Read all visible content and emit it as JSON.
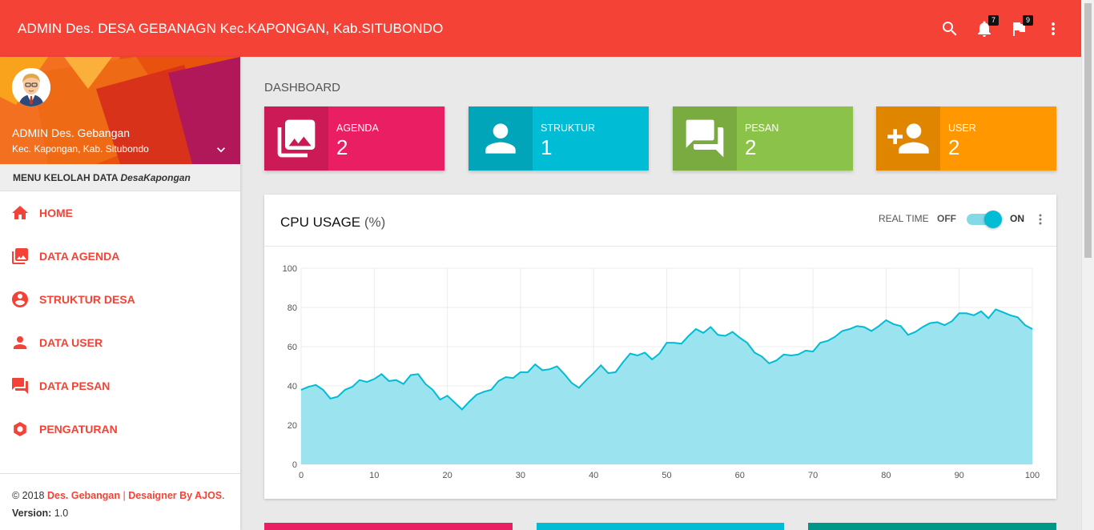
{
  "header": {
    "brand": "ADMIN Des. DESA GEBANAGN Kec.KAPONGAN, Kab.SITUBONDO",
    "notifications_count": "7",
    "flags_count": "9",
    "icons": [
      "search-icon",
      "bell-icon",
      "flag-icon",
      "more-vert-icon"
    ]
  },
  "sidebar": {
    "user_name": "ADMIN Des. Gebangan",
    "user_location": "Kec. Kapongan, Kab. Situbondo",
    "menu_title": "MENU KELOLAH DATA",
    "menu_title_italic": "DesaKapongan",
    "items": [
      {
        "label": "HOME",
        "icon": "home-icon"
      },
      {
        "label": "DATA AGENDA",
        "icon": "photo-library-icon"
      },
      {
        "label": "STRUKTUR DESA",
        "icon": "account-circle-icon"
      },
      {
        "label": "DATA USER",
        "icon": "person-icon"
      },
      {
        "label": "DATA PESAN",
        "icon": "forum-icon"
      },
      {
        "label": "PENGATURAN",
        "icon": "settings-icon"
      }
    ],
    "legal": {
      "copyright": "© 2018",
      "site_name": "Des. Gebangan",
      "separator": "|",
      "designer": "Desaigner By AJOS",
      "end": ".",
      "version_label": "Version:",
      "version": "1.0"
    }
  },
  "main": {
    "page_title": "DASHBOARD",
    "info_boxes": [
      {
        "label": "AGENDA",
        "value": "2",
        "color": "#e91e63",
        "icon": "photo-library-icon"
      },
      {
        "label": "STRUKTUR",
        "value": "1",
        "color": "#00bcd4",
        "icon": "person-icon"
      },
      {
        "label": "PESAN",
        "value": "2",
        "color": "#8bc34a",
        "icon": "forum-icon"
      },
      {
        "label": "USER",
        "value": "2",
        "color": "#ff9800",
        "icon": "person-add-icon"
      }
    ],
    "cpu_card": {
      "title": "CPU USAGE",
      "title_unit": "(%)",
      "realtime_label": "REAL TIME",
      "off_label": "OFF",
      "on_label": "ON",
      "realtime_on": true
    },
    "bottom_colors": [
      "#e91e63",
      "#00bcd4",
      "#009688"
    ]
  },
  "chart_data": {
    "type": "area",
    "color": "#00bcd4",
    "fill": "#9be3ee",
    "xlim": [
      0,
      100
    ],
    "ylim": [
      0,
      100
    ],
    "x_ticks": [
      0,
      10,
      20,
      30,
      40,
      50,
      60,
      70,
      80,
      90,
      100
    ],
    "y_ticks": [
      0,
      20,
      40,
      60,
      80,
      100
    ],
    "grid": true,
    "values": [
      38,
      39.5,
      40.5,
      38,
      33.5,
      34.5,
      38,
      39.5,
      43,
      42,
      43.5,
      46,
      42.5,
      43,
      41,
      45.5,
      46,
      41,
      38,
      33,
      35,
      31.5,
      28,
      32,
      35.5,
      37,
      38,
      42.5,
      44.5,
      44,
      47,
      47,
      51,
      48,
      48.5,
      50,
      46,
      41.5,
      39,
      43,
      46.5,
      50.5,
      46.5,
      47,
      52,
      56.5,
      55.5,
      57,
      53.5,
      56.5,
      62,
      62,
      61.5,
      65.5,
      69,
      67,
      70,
      66,
      65.5,
      67.5,
      64.5,
      62,
      57,
      55,
      51.5,
      53,
      56,
      55.5,
      56,
      58,
      57.5,
      62,
      63,
      65,
      68,
      69,
      70.5,
      70,
      68,
      70.5,
      73.5,
      71.5,
      70.5,
      66,
      67.5,
      70,
      72,
      72.5,
      71,
      73,
      77,
      77,
      76,
      78,
      74.5,
      79,
      77.5,
      76,
      75,
      71,
      69
    ]
  }
}
